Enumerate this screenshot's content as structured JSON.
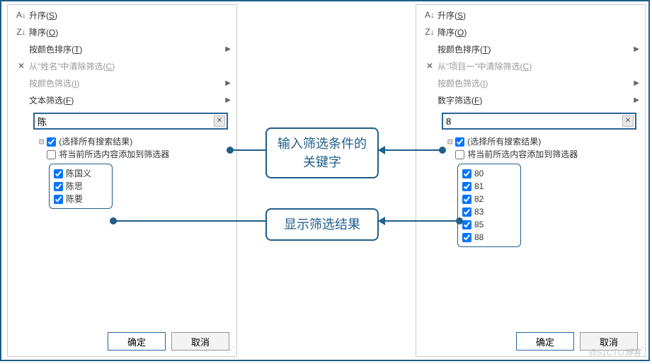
{
  "left": {
    "sort_asc": "升序(<u>S</u>)",
    "sort_desc": "降序(<u>O</u>)",
    "sort_by_color": "按颜色排序(<u>T</u>)",
    "clear_filter": "从\"姓名\"中清除筛选(<u>C</u>)",
    "filter_by_color": "按颜色筛选(<u>I</u>)",
    "text_filter": "文本筛选(<u>F</u>)",
    "search_value": "陈",
    "select_all": "(选择所有搜索结果)",
    "add_current": "将当前所选内容添加到筛选器",
    "results": [
      "陈国义",
      "陈思",
      "陈要"
    ]
  },
  "right": {
    "sort_asc": "升序(<u>S</u>)",
    "sort_desc": "降序(<u>O</u>)",
    "sort_by_color": "按颜色排序(<u>T</u>)",
    "clear_filter": "从\"项目一\"中清除筛选(<u>C</u>)",
    "filter_by_color": "按颜色筛选(<u>I</u>)",
    "number_filter": "数字筛选(<u>F</u>)",
    "search_value": "8",
    "select_all": "(选择所有搜索结果)",
    "add_current": "将当前所选内容添加到筛选器",
    "results": [
      "80",
      "81",
      "82",
      "83",
      "85",
      "88"
    ]
  },
  "buttons": {
    "ok": "确定",
    "cancel": "取消"
  },
  "callouts": {
    "top": "输入筛选条件的关键字",
    "bottom": "显示筛选结果"
  },
  "watermark": "@51CTO博客"
}
